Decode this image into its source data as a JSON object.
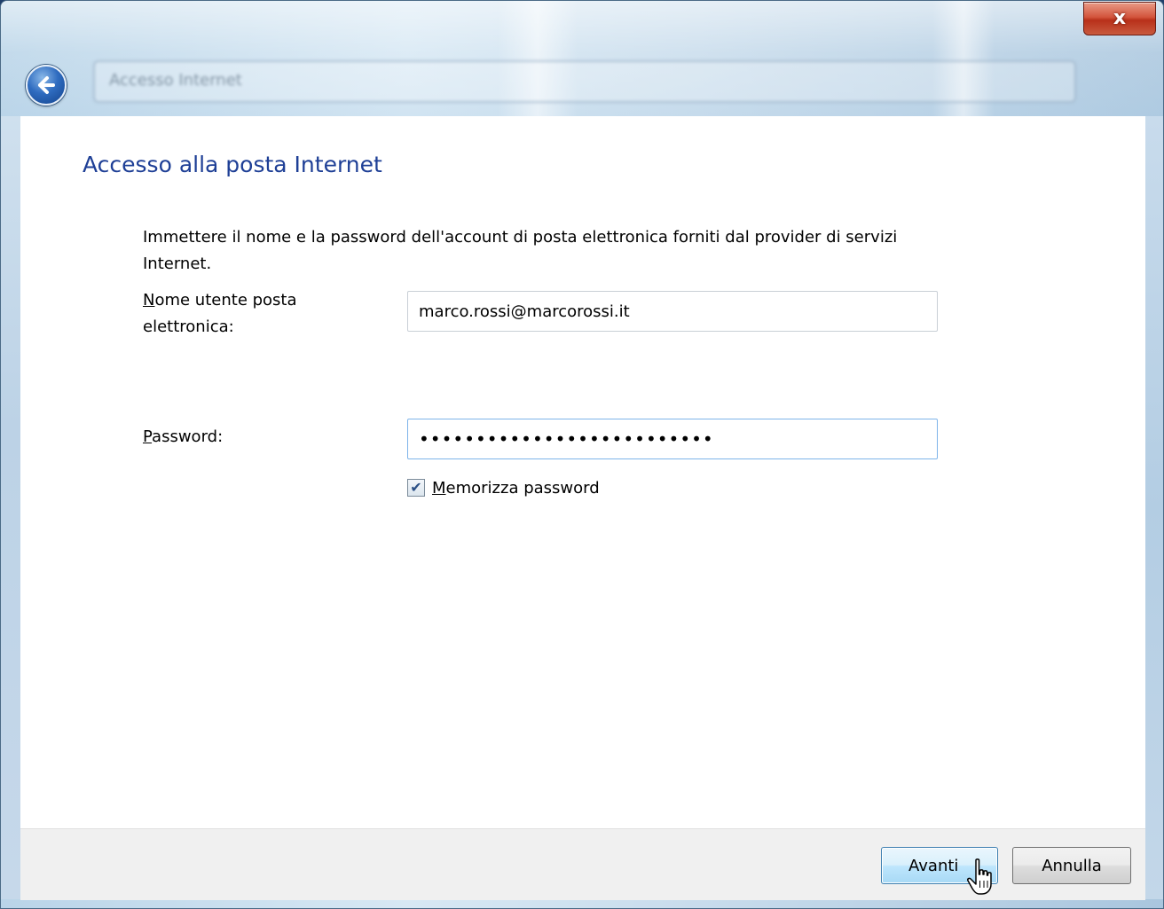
{
  "window": {
    "address_text": "Accesso Internet",
    "close_glyph": "x"
  },
  "page": {
    "title": "Accesso alla posta Internet",
    "description": "Immettere il nome e la password dell'account di posta elettronica forniti dal provider di servizi Internet."
  },
  "form": {
    "username": {
      "label_mnemonic": "N",
      "label_rest": "ome utente posta elettronica:",
      "value": "marco.rossi@marcorossi.it"
    },
    "password": {
      "label_mnemonic": "P",
      "label_rest": "assword:",
      "value": "••••••••••••••••••••••••••"
    },
    "remember": {
      "checked": true,
      "label_mnemonic": "M",
      "label_rest": "emorizza password"
    }
  },
  "footer": {
    "next_label": "Avanti",
    "cancel_label": "Annulla"
  },
  "icons": {
    "back": "back-arrow-icon",
    "close": "close-icon",
    "check": "checkmark-icon",
    "cursor": "hand-pointer-icon"
  },
  "colors": {
    "title": "#1e3f96",
    "close_button": "#c84a30",
    "focus_border": "#7eb4ea",
    "default_button_border": "#3c7fb1"
  }
}
